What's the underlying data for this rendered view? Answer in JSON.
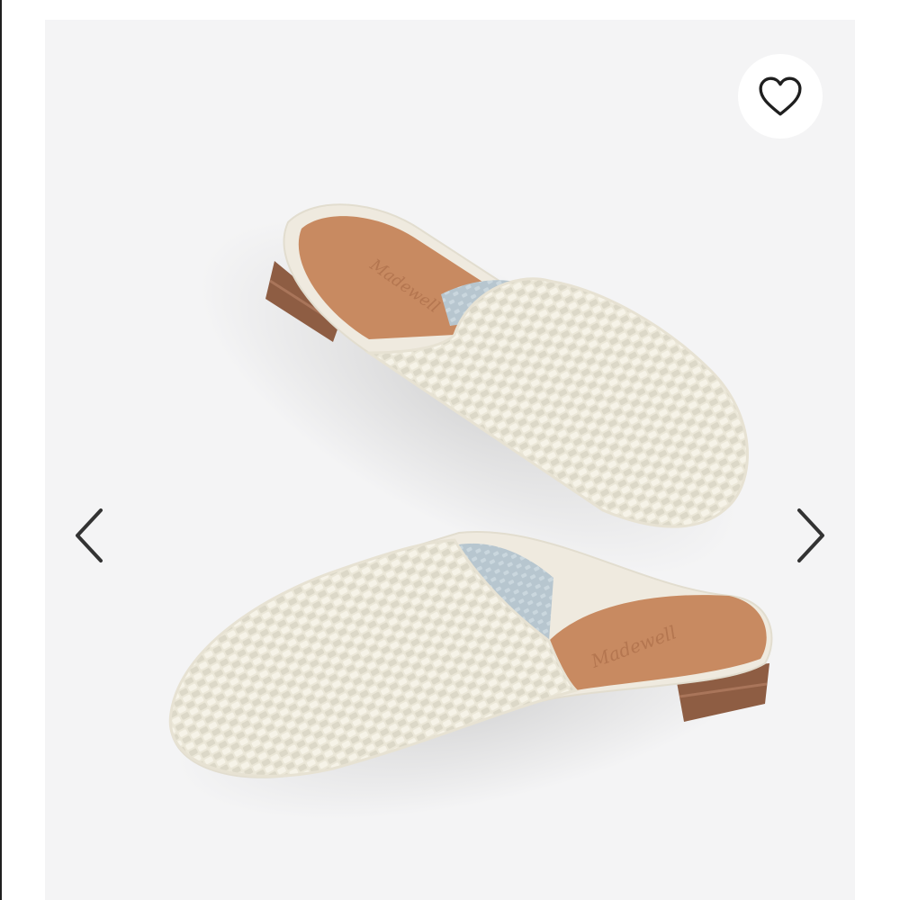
{
  "carousel": {
    "background_color": "#f4f4f5",
    "image": {
      "subject": "pair of woven leather mules",
      "colors": {
        "upper": "#ece8da",
        "insole": "#c88a61",
        "heel": "#8e5d43",
        "lining": "#b9c8d1"
      },
      "insole_logo": "Madewell"
    },
    "favorite_button": {
      "icon": "heart-icon",
      "state": "not-favorited"
    },
    "prev_button": {
      "icon": "chevron-left-icon"
    },
    "next_button": {
      "icon": "chevron-right-icon"
    }
  }
}
